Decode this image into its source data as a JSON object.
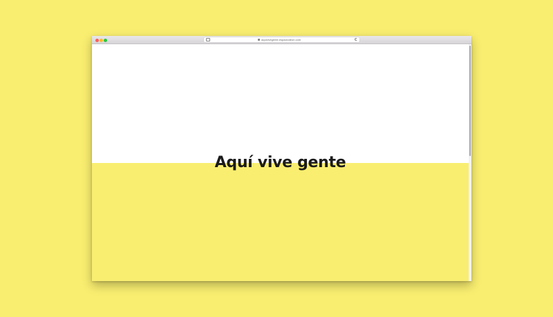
{
  "browser": {
    "url": "aquivivegente.espaciodeon.com"
  },
  "page": {
    "headline": "Aquí vive gente"
  },
  "colors": {
    "background": "#f9ee70",
    "accent_yellow": "#f9ee70",
    "headline_text": "#1b1b1b"
  }
}
